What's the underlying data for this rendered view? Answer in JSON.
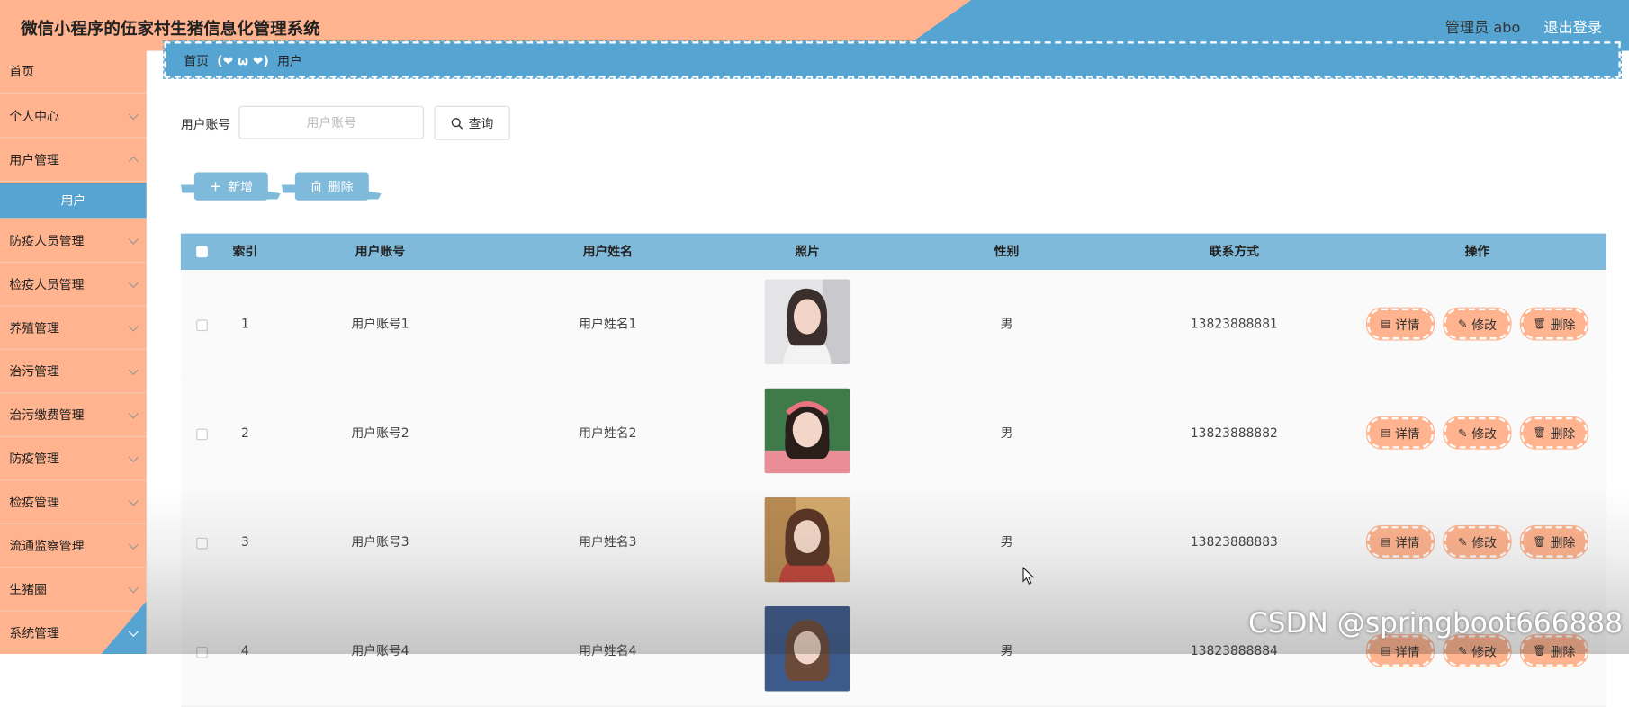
{
  "header": {
    "title": "微信小程序的伍家村生猪信息化管理系统",
    "admin_label": "管理员 abo",
    "logout_label": "退出登录"
  },
  "sidebar": {
    "items": [
      {
        "label": "首页",
        "has_children": false
      },
      {
        "label": "个人中心",
        "has_children": true
      },
      {
        "label": "用户管理",
        "has_children": true
      },
      {
        "label": "用户",
        "sub": true
      },
      {
        "label": "防疫人员管理",
        "has_children": true
      },
      {
        "label": "检疫人员管理",
        "has_children": true
      },
      {
        "label": "养殖管理",
        "has_children": true
      },
      {
        "label": "治污管理",
        "has_children": true
      },
      {
        "label": "治污缴费管理",
        "has_children": true
      },
      {
        "label": "防疫管理",
        "has_children": true
      },
      {
        "label": "检疫管理",
        "has_children": true
      },
      {
        "label": "流通监察管理",
        "has_children": true
      },
      {
        "label": "生猪圈",
        "has_children": true
      },
      {
        "label": "系统管理",
        "has_children": true
      }
    ]
  },
  "breadcrumb": {
    "home": "首页",
    "separator": "(❤ ω ❤)",
    "current": "用户"
  },
  "search": {
    "label": "用户账号",
    "placeholder": "用户账号",
    "value": "",
    "button_label": "查询"
  },
  "toolbar": {
    "add_label": "新增",
    "delete_label": "删除"
  },
  "table": {
    "columns": [
      "索引",
      "用户账号",
      "用户姓名",
      "照片",
      "性别",
      "联系方式",
      "操作"
    ],
    "rows": [
      {
        "index": "1",
        "account": "用户账号1",
        "name": "用户姓名1",
        "gender": "男",
        "phone": "13823888881"
      },
      {
        "index": "2",
        "account": "用户账号2",
        "name": "用户姓名2",
        "gender": "男",
        "phone": "13823888882"
      },
      {
        "index": "3",
        "account": "用户账号3",
        "name": "用户姓名3",
        "gender": "男",
        "phone": "13823888883"
      },
      {
        "index": "4",
        "account": "用户账号4",
        "name": "用户姓名4",
        "gender": "男",
        "phone": "13823888884"
      }
    ],
    "actions": {
      "detail": "详情",
      "edit": "修改",
      "delete": "删除"
    }
  },
  "watermark": "CSDN @springboot666888",
  "colors": {
    "peach": "#ffb38e",
    "blue": "#56a4d1",
    "light_blue": "#7fbadb"
  }
}
